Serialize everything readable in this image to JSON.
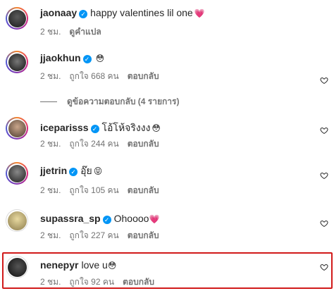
{
  "caption": {
    "username": "jaonaay",
    "text": "happy valentines lil one",
    "emoji": "💗",
    "time": "2 ชม.",
    "translate_label": "ดูคำแปล"
  },
  "comments": [
    {
      "username": "jjaokhun",
      "text": "",
      "emoji": "😳",
      "time": "2 ชม.",
      "likes": "ถูกใจ 668 คน",
      "reply_label": "ตอบกลับ",
      "view_replies": "ดูข้อความตอบกลับ (4 รายการ)"
    },
    {
      "username": "iceparisss",
      "text": "โอ้โห้จริงงง",
      "emoji": "😳",
      "time": "2 ชม.",
      "likes": "ถูกใจ 244 คน",
      "reply_label": "ตอบกลับ"
    },
    {
      "username": "jjetrin",
      "text": "อุ๊ย",
      "emoji": "😝",
      "time": "2 ชม.",
      "likes": "ถูกใจ 105 คน",
      "reply_label": "ตอบกลับ"
    },
    {
      "username": "supassra_sp",
      "text": "Ohoooo",
      "emoji": "💗",
      "time": "2 ชม.",
      "likes": "ถูกใจ 227 คน",
      "reply_label": "ตอบกลับ"
    },
    {
      "username": "nenepyr",
      "text": "love u",
      "emoji": "😳",
      "time": "2 ชม.",
      "likes": "ถูกใจ 92 คน",
      "reply_label": "ตอบกลับ"
    }
  ],
  "colors": {
    "verified": "#0095f6",
    "highlight": "#d11a1a",
    "meta_text": "#737373"
  }
}
